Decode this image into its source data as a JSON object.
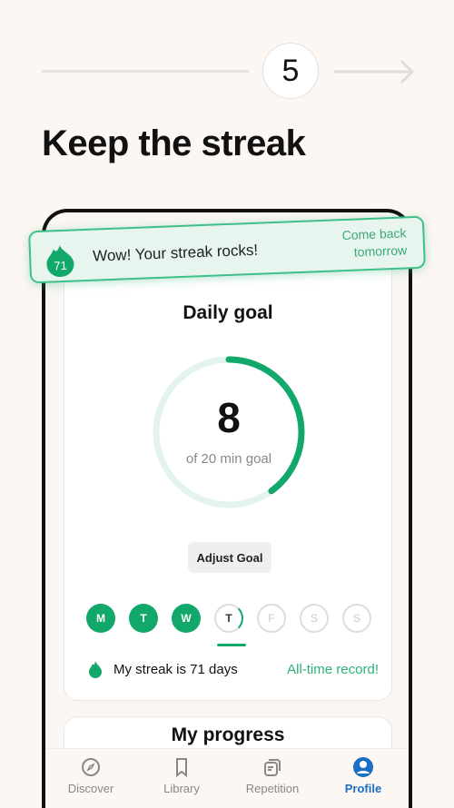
{
  "step": {
    "number": "5"
  },
  "title": "Keep the streak",
  "banner": {
    "badge": "71",
    "message": "Wow! Your streak rocks!",
    "action": "Come back tomorrow"
  },
  "daily_goal": {
    "title": "Daily goal",
    "value": "8",
    "subtitle": "of 20 min goal",
    "progress": 0.4,
    "adjust_label": "Adjust Goal"
  },
  "days": [
    {
      "label": "M",
      "state": "done"
    },
    {
      "label": "T",
      "state": "done"
    },
    {
      "label": "W",
      "state": "done"
    },
    {
      "label": "T",
      "state": "today"
    },
    {
      "label": "F",
      "state": "future"
    },
    {
      "label": "S",
      "state": "future"
    },
    {
      "label": "S",
      "state": "future"
    }
  ],
  "streak": {
    "text": "My streak is 71 days",
    "record": "All-time record!"
  },
  "progress_card": {
    "title": "My progress"
  },
  "nav": [
    {
      "label": "Discover",
      "icon": "compass-icon"
    },
    {
      "label": "Library",
      "icon": "bookmark-icon"
    },
    {
      "label": "Repetition",
      "icon": "cards-icon"
    },
    {
      "label": "Profile",
      "icon": "profile-icon",
      "active": true
    }
  ],
  "colors": {
    "accent": "#12a86b",
    "active_nav": "#1a6ec4",
    "background": "#fcf7f2"
  }
}
